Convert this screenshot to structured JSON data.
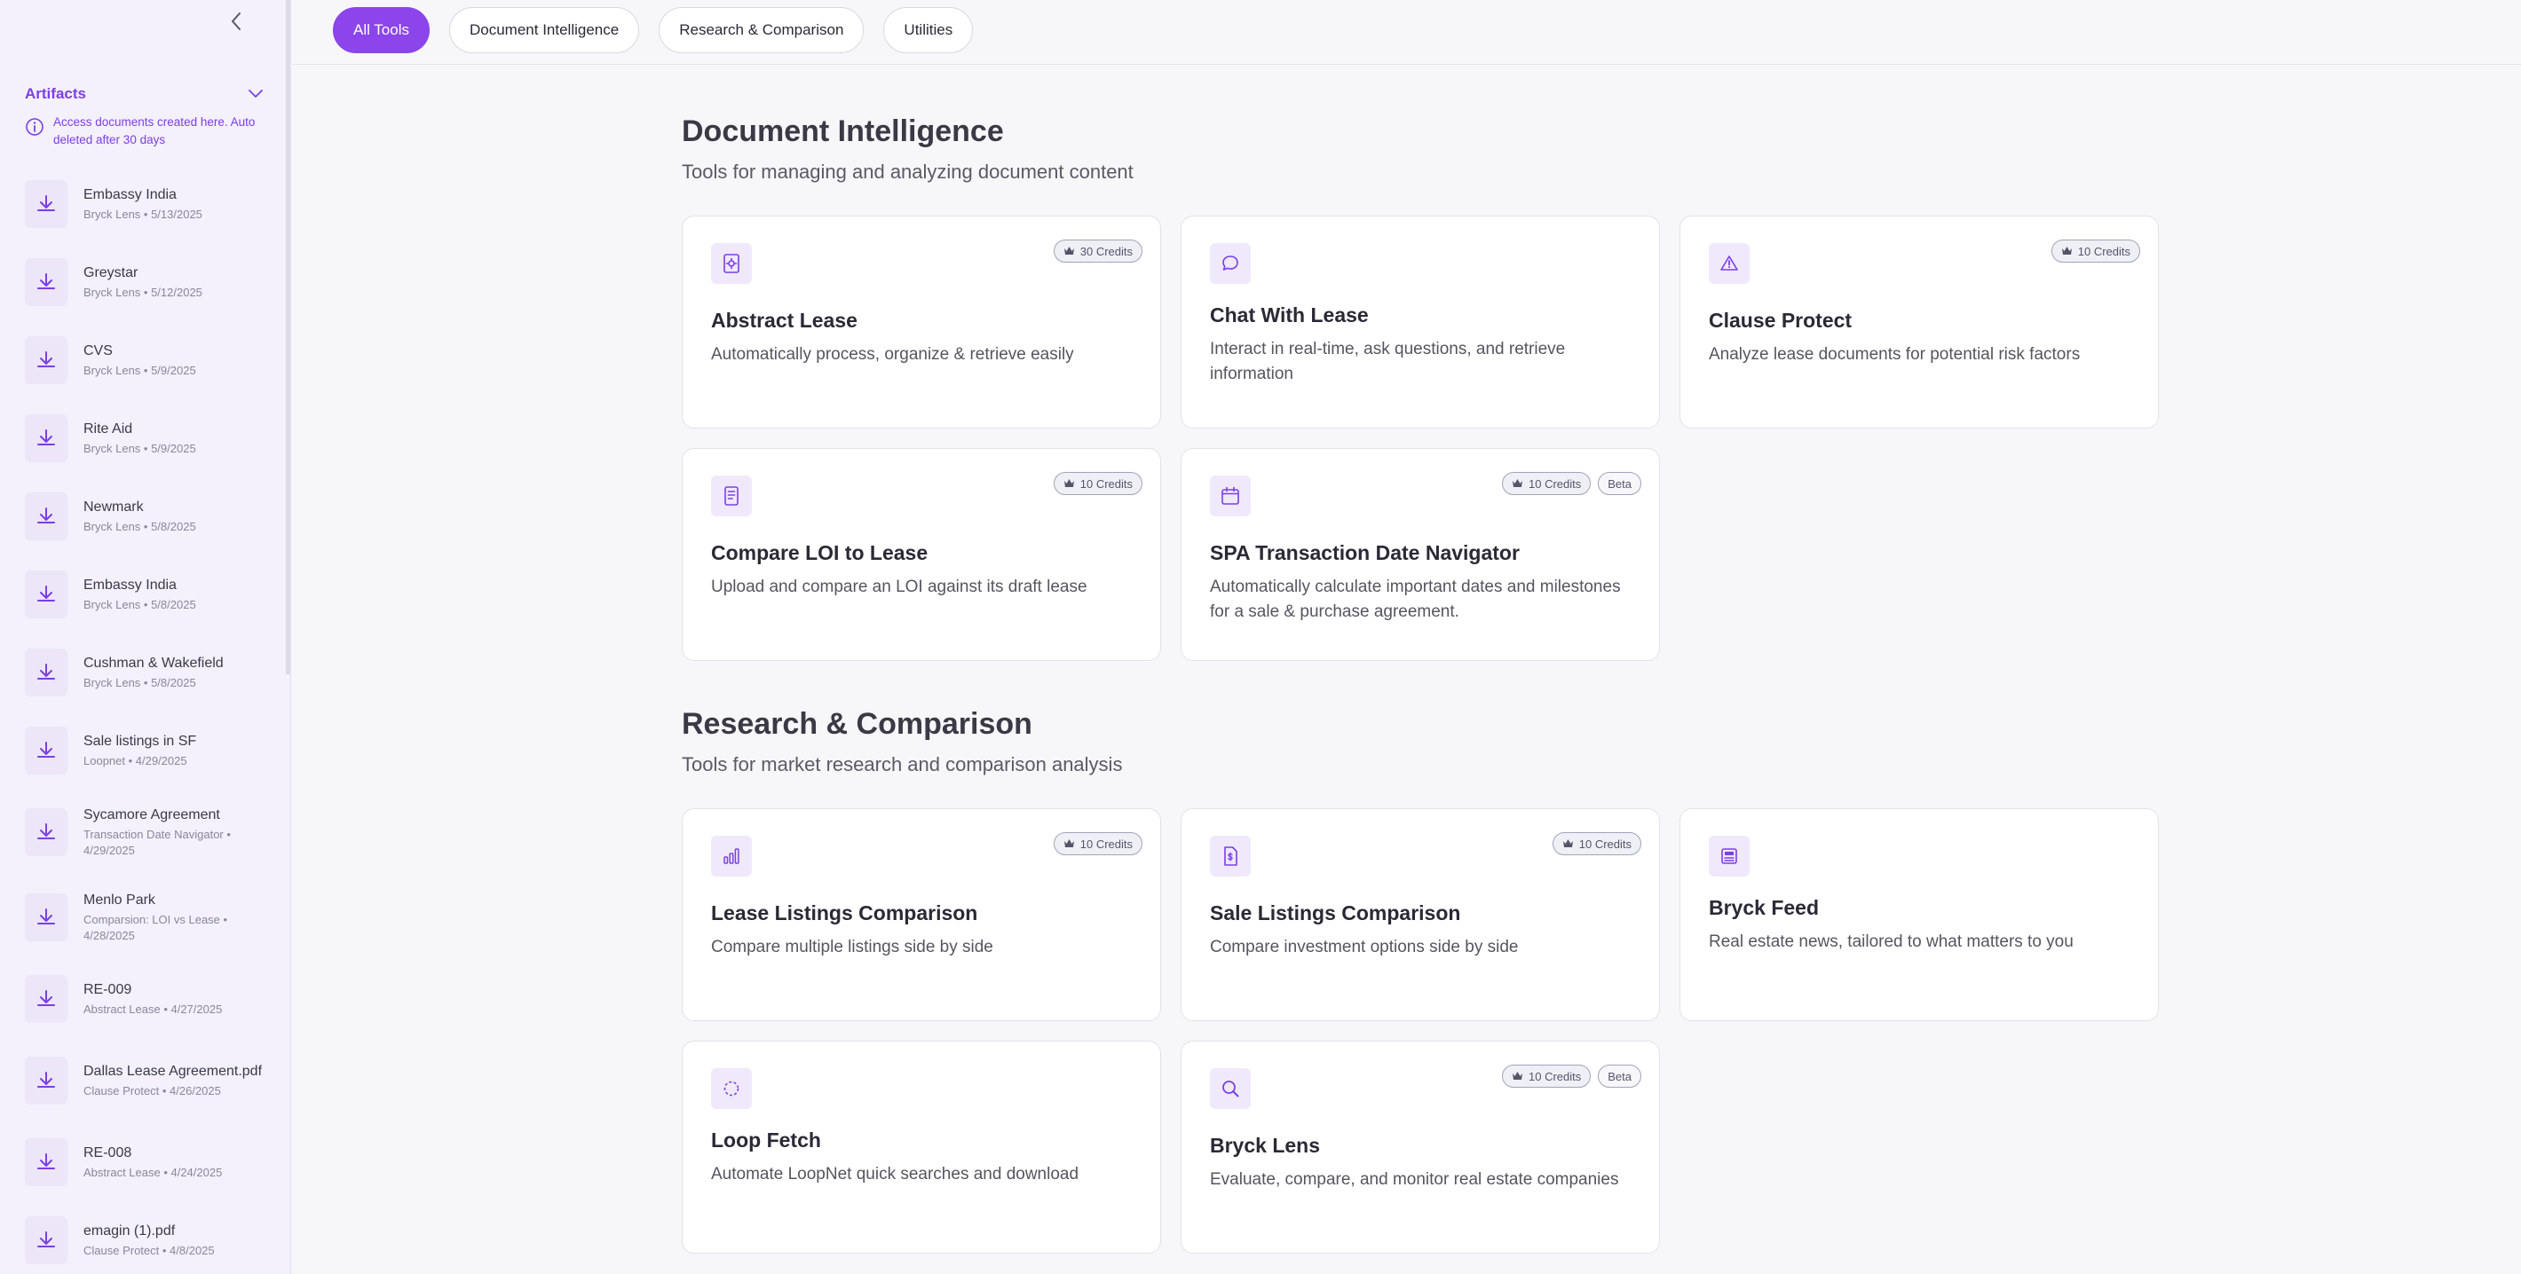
{
  "sidebar": {
    "title": "Artifacts",
    "note": "Access documents created here. Auto deleted after 30 days",
    "items": [
      {
        "name": "Embassy India",
        "meta": "Bryck Lens • 5/13/2025"
      },
      {
        "name": "Greystar",
        "meta": "Bryck Lens • 5/12/2025"
      },
      {
        "name": "CVS",
        "meta": "Bryck Lens • 5/9/2025"
      },
      {
        "name": "Rite Aid",
        "meta": "Bryck Lens • 5/9/2025"
      },
      {
        "name": "Newmark",
        "meta": "Bryck Lens • 5/8/2025"
      },
      {
        "name": "Embassy India",
        "meta": "Bryck Lens • 5/8/2025"
      },
      {
        "name": "Cushman & Wakefield",
        "meta": "Bryck Lens • 5/8/2025"
      },
      {
        "name": "Sale listings in SF",
        "meta": "Loopnet • 4/29/2025"
      },
      {
        "name": "Sycamore Agreement",
        "meta": "Transaction Date Navigator • 4/29/2025"
      },
      {
        "name": "Menlo Park",
        "meta": "Comparsion: LOI vs Lease • 4/28/2025"
      },
      {
        "name": "RE-009",
        "meta": "Abstract Lease • 4/27/2025"
      },
      {
        "name": "Dallas Lease Agreement.pdf",
        "meta": "Clause Protect • 4/26/2025"
      },
      {
        "name": "RE-008",
        "meta": "Abstract Lease • 4/24/2025"
      },
      {
        "name": "emagin (1).pdf",
        "meta": "Clause Protect • 4/8/2025"
      }
    ]
  },
  "filters": [
    "All Tools",
    "Document Intelligence",
    "Research & Comparison",
    "Utilities"
  ],
  "sections": [
    {
      "title": "Document Intelligence",
      "subtitle": "Tools for managing and analyzing document content",
      "cards": [
        {
          "title": "Abstract Lease",
          "desc": "Automatically process, organize & retrieve easily",
          "credits": "30 Credits",
          "beta": "",
          "icon": "gear-doc-icon"
        },
        {
          "title": "Chat With Lease",
          "desc": "Interact in real-time, ask questions, and retrieve information",
          "credits": "",
          "beta": "",
          "icon": "chat-bubble-icon"
        },
        {
          "title": "Clause Protect",
          "desc": "Analyze lease documents for potential risk factors",
          "credits": "10 Credits",
          "beta": "",
          "icon": "warning-triangle-icon"
        },
        {
          "title": "Compare LOI to Lease",
          "desc": "Upload and compare an LOI against its draft lease",
          "credits": "10 Credits",
          "beta": "",
          "icon": "document-lines-icon"
        },
        {
          "title": "SPA Transaction Date Navigator",
          "desc": "Automatically calculate important dates and milestones for a sale & purchase agreement.",
          "credits": "10 Credits",
          "beta": "Beta",
          "icon": "calendar-icon"
        }
      ]
    },
    {
      "title": "Research & Comparison",
      "subtitle": "Tools for market research and comparison analysis",
      "cards": [
        {
          "title": "Lease Listings Comparison",
          "desc": "Compare multiple listings side by side",
          "credits": "10 Credits",
          "beta": "",
          "icon": "bar-chart-icon"
        },
        {
          "title": "Sale Listings Comparison",
          "desc": "Compare investment options side by side",
          "credits": "10 Credits",
          "beta": "",
          "icon": "dollar-doc-icon"
        },
        {
          "title": "Bryck Feed",
          "desc": "Real estate news, tailored to what matters to you",
          "credits": "",
          "beta": "",
          "icon": "newspaper-icon"
        },
        {
          "title": "Loop Fetch",
          "desc": "Automate LoopNet quick searches and download",
          "credits": "",
          "beta": "",
          "icon": "loading-circle-icon"
        },
        {
          "title": "Bryck Lens",
          "desc": "Evaluate, compare, and monitor real estate companies",
          "credits": "10 Credits",
          "beta": "Beta",
          "icon": "magnifier-icon"
        }
      ]
    }
  ],
  "colors": {
    "accent": "#8b45ea",
    "accent_text": "#7b3fe4",
    "icon_bg": "#efe9fb"
  }
}
